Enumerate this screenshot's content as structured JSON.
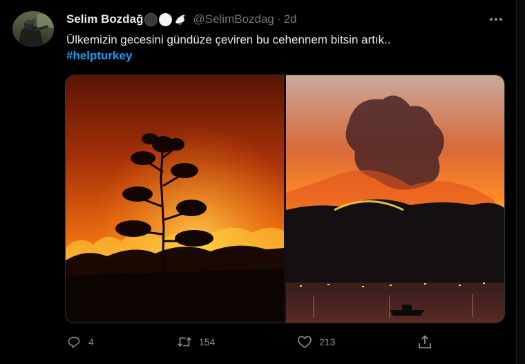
{
  "tweet": {
    "author": {
      "display_name": "Selim Bozdağ",
      "handle": "@SelimBozdag",
      "name_emojis": [
        "black-circle",
        "white-circle",
        "eagle"
      ]
    },
    "separator": "·",
    "time": "2d",
    "text": "Ülkemizin gecesini gündüze çeviren bu cehennem bitsin artık..",
    "hashtag": "#helpturkey",
    "media": [
      {
        "description_icon": "wildfire-tree-photo"
      },
      {
        "description_icon": "wildfire-coast-photo"
      }
    ],
    "actions": {
      "replies": "4",
      "retweets": "154",
      "likes": "213"
    }
  },
  "colors": {
    "background": "#000000",
    "text": "#e7e9ea",
    "muted": "#71767b",
    "link": "#1d9bf0",
    "border": "#333333"
  }
}
